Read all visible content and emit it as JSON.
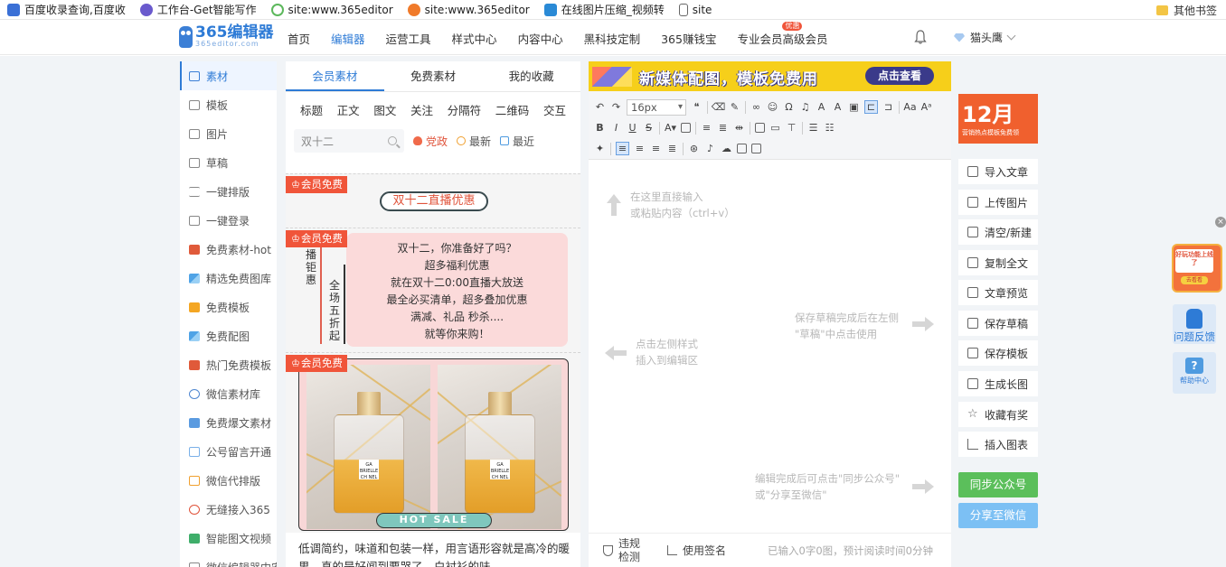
{
  "bookmarks": [
    {
      "label": "百度收录查询,百度收",
      "color": "#3a70d6"
    },
    {
      "label": "工作台-Get智能写作",
      "color": "#6a5acd"
    },
    {
      "label": "site:www.365editor",
      "color": "#5cb85c"
    },
    {
      "label": "site:www.365editor",
      "color": "#f07a2a"
    },
    {
      "label": "在线图片压缩_视频转",
      "color": "#2a8ad6"
    },
    {
      "label": "site",
      "color": "#ffffff"
    }
  ],
  "bookmarks_other": "其他书签",
  "logo": {
    "name": "365编辑器",
    "sub": "365editor.com"
  },
  "nav": [
    "首页",
    "编辑器",
    "运营工具",
    "样式中心",
    "内容中心",
    "黑科技定制",
    "365赚钱宝",
    "专业会员",
    "高级会员"
  ],
  "nav_badge": "优惠",
  "user": {
    "name": "猫头鹰"
  },
  "sidebar": [
    "素材",
    "模板",
    "图片",
    "草稿",
    "一键排版",
    "一键登录",
    "免费素材-hot",
    "精选免费图库",
    "免费模板",
    "免费配图",
    "热门免费模板",
    "微信素材库",
    "免费爆文素材",
    "公号留言开通",
    "微信代排版",
    "无缝接入365",
    "智能图文视频",
    "微信编辑器中安"
  ],
  "material": {
    "tabs": [
      "会员素材",
      "免费素材",
      "我的收藏"
    ],
    "categories": [
      "标题",
      "正文",
      "图文",
      "关注",
      "分隔符",
      "二维码",
      "交互"
    ],
    "search_value": "双十二",
    "filters": [
      "党政",
      "最新",
      "最近"
    ],
    "vip_tag": "会员免费",
    "card1_pill": "双十二直播优惠",
    "card2_vert1": "播钜惠",
    "card2_vert2": "全场五折起",
    "card2_lines": [
      "双十二，你准备好了吗？",
      "超多福利优惠",
      "就在双十二0:00直播大放送",
      "最全必买清单，超多叠加优惠",
      "满减、礼品 秒杀....",
      "就等你来购！"
    ],
    "hot_sale": "HOT SALE",
    "bottle_label": "GA BRIELLE CH NEL",
    "card3_text": "低调简约，味道和包装一样，用言语形容就是高冷的暖男，真的是好闻到要哭了，白衬衫的味"
  },
  "editor": {
    "banner_text": "新媒体配图，模板免费用",
    "banner_btn": "点击查看",
    "font_size": "16px",
    "hint_input": "在这里直接输入\n或粘贴内容（ctrl+v）",
    "hint_left": "点击左侧样式\n插入到编辑区",
    "hint_save": "保存草稿完成后在左侧\n\"草稿\"中点击使用",
    "hint_sync": "编辑完成后可点击\"同步公众号\"\n或\"分享至微信\"",
    "footer_check": "违规检测",
    "footer_sign": "使用签名",
    "word_count": "已输入0字0图，预计阅读时间0分钟"
  },
  "promo": {
    "big": "12月",
    "small": "营销热点模板免费领"
  },
  "tools": [
    "导入文章",
    "上传图片",
    "清空/新建",
    "复制全文",
    "文章预览",
    "保存草稿",
    "保存模板",
    "生成长图",
    "收藏有奖",
    "插入图表"
  ],
  "btn_sync": "同步公众号",
  "btn_share": "分享至微信",
  "float_promo": {
    "text": "好玩功能上线了",
    "btn": "去看看"
  },
  "feedback": "问题反馈",
  "help": "帮助中心"
}
